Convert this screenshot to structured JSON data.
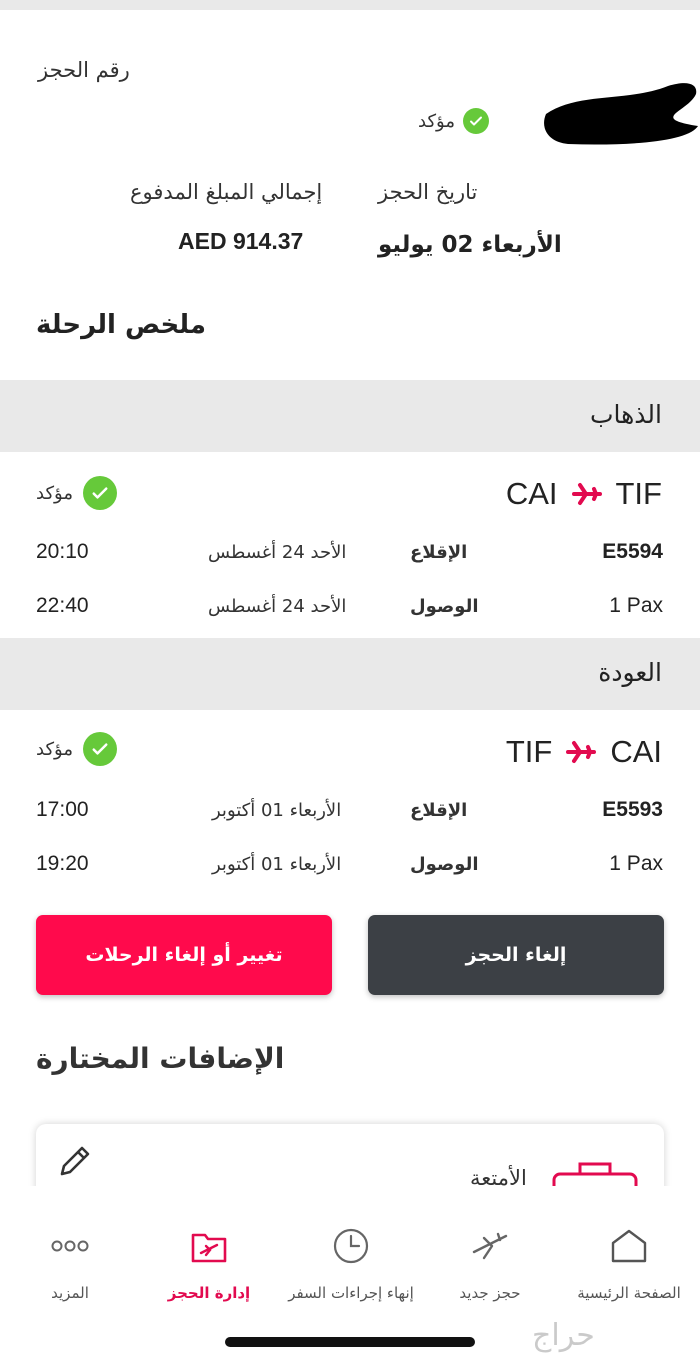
{
  "booking": {
    "ref_label": "رقم الحجز",
    "status": "مؤكد",
    "date_label": "تاريخ الحجز",
    "date_value": "الأربعاء 02 يوليو",
    "total_label": "إجمالي المبلغ المدفوع",
    "total_value": "AED 914.37"
  },
  "summary_title": "ملخص الرحلة",
  "outbound": {
    "header": "الذهاب",
    "from": "TIF",
    "to": "CAI",
    "status": "مؤكد",
    "flight_no": "E5594",
    "pax": "1 Pax",
    "dep_label": "الإقلاع",
    "arr_label": "الوصول",
    "dep_date": "الأحد 24 أغسطس",
    "arr_date": "الأحد 24 أغسطس",
    "dep_time": "20:10",
    "arr_time": "22:40"
  },
  "return": {
    "header": "العودة",
    "from": "CAI",
    "to": "TIF",
    "status": "مؤكد",
    "flight_no": "E5593",
    "pax": "1 Pax",
    "dep_label": "الإقلاع",
    "arr_label": "الوصول",
    "dep_date": "الأربعاء 01 أكتوبر",
    "arr_date": "الأربعاء 01 أكتوبر",
    "dep_time": "17:00",
    "arr_time": "19:20"
  },
  "actions": {
    "cancel_booking": "إلغاء الحجز",
    "change_cancel_flights": "تغيير أو إلغاء الرحلات"
  },
  "extras": {
    "title": "الإضافات المختارة",
    "baggage_label": "الأمتعة"
  },
  "nav": {
    "home": "الصفحة الرئيسية",
    "new_booking": "حجز جديد",
    "check_in": "إنهاء إجراءات السفر",
    "manage": "إدارة الحجز",
    "more": "المزيد"
  },
  "colors": {
    "accent": "#e20a4f",
    "confirmed_green": "#66c93a",
    "dark_button": "#3c4045"
  },
  "watermark": "حراج"
}
